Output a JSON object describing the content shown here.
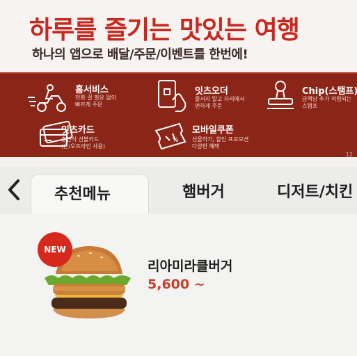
{
  "banner": {
    "headline": "하루를 즐기는 맛있는 여행",
    "subline": "하나의 앱으로 배달/주문/이벤트를 한번에!",
    "page_indicator": "12",
    "features": [
      {
        "title": "홈서비스",
        "desc": [
          "전화 걸 필요 없이",
          "빠르게 주문"
        ],
        "icon": "delivery-scooter-icon"
      },
      {
        "title": "잇츠오더",
        "desc": [
          "줄서지 말고 자리에서",
          "편하게 주문"
        ],
        "icon": "phone-tap-icon"
      },
      {
        "title": "Chip(스탬프)",
        "desc": [
          "금액당 추가 적립되는",
          "스탬프"
        ],
        "icon": "stamp-icon"
      },
      {
        "title": "잇츠카드",
        "desc": [
          "충전식 선불카드",
          "(온/오프라인 사용)"
        ],
        "icon": "card-icon"
      },
      {
        "title": "모바일쿠폰",
        "desc": [
          "선물하기, 할인 프로모션",
          "다양한 혜택"
        ],
        "icon": "coupon-icon"
      }
    ]
  },
  "tabs": {
    "back_icon": "chevron-left-icon",
    "items": [
      {
        "label": "추천메뉴",
        "active": true
      },
      {
        "label": "햄버거",
        "active": false
      },
      {
        "label": "디저트/치킨",
        "active": false
      }
    ]
  },
  "menu": {
    "items": [
      {
        "badge": "NEW",
        "name": "리아미라클버거",
        "price": "5,600 ~",
        "image": "burger-image"
      }
    ]
  },
  "colors": {
    "brand_red": "#c8281e",
    "banner_dark": "#8b2518",
    "price_red": "#c8422e"
  }
}
